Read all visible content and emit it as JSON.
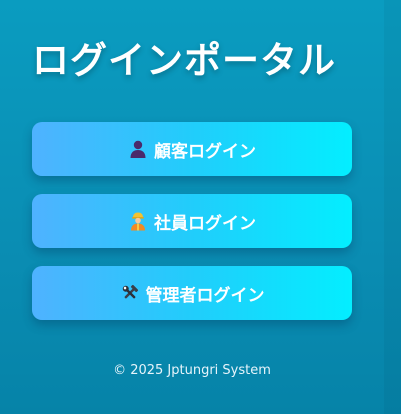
{
  "page": {
    "title": "ログインポータル"
  },
  "buttons": [
    {
      "icon": "customer-person-icon",
      "label": "顧客ログイン"
    },
    {
      "icon": "worker-person-icon",
      "label": "社員ログイン"
    },
    {
      "icon": "tools-icon",
      "label": "管理者ログイン"
    }
  ],
  "footer": {
    "text": "© 2025 Jptungri System"
  },
  "colors": {
    "background": "#0a96bb",
    "button_start": "#4fb2ff",
    "button_end": "#03eeff",
    "text": "#ffffff"
  }
}
